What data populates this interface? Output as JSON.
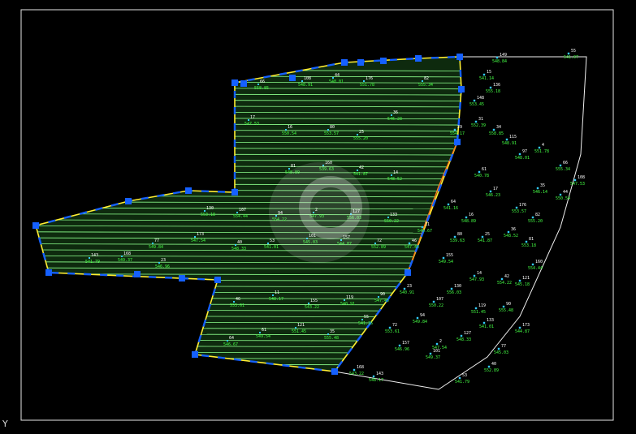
{
  "app": {
    "name": "CAD model space"
  },
  "colors": {
    "background": "#000000",
    "frame": "#e6e6e6",
    "boundary": "#f0f0f0",
    "polyline": "#ffee33",
    "hatch": "#8cff8c",
    "fill": "#0e2a0e",
    "grip": "#1560ff",
    "cut_line": "#ff7a1a",
    "label_text": "#44ff44",
    "label_number": "#ffffff",
    "point_marker": "#33ccff",
    "watermark": "#ffffff"
  },
  "ucs_axis_label": "Y",
  "survey": {
    "spot_elevations": [
      "541.07",
      "548.84",
      "541.14",
      "555.18",
      "553.45",
      "552.39",
      "554.17",
      "558.85",
      "548.91",
      "548.01",
      "551.78",
      "555.34",
      "547.53",
      "550.54",
      "553.57",
      "555.20",
      "546.23",
      "548.89",
      "539.63",
      "541.87",
      "548.52",
      "553.18",
      "554.44",
      "554.22",
      "547.93",
      "556.03",
      "550.22",
      "549.84",
      "547.54",
      "548.33",
      "541.01",
      "545.03",
      "544.87",
      "552.89",
      "541.79",
      "549.37",
      "546.96",
      "553.61",
      "548.17",
      "543.22",
      "540.91",
      "547.45",
      "546.67",
      "549.54",
      "551.45",
      "555.48",
      "541.16",
      "540.78",
      "545.18",
      "546.14"
    ],
    "point_numbers": [
      "55",
      "149",
      "15",
      "136",
      "148",
      "31",
      "29",
      "34",
      "115",
      "97",
      "4",
      "66",
      "108",
      "44",
      "176",
      "82",
      "17",
      "16",
      "80",
      "25",
      "36",
      "81",
      "160",
      "42",
      "14",
      "130",
      "107",
      "94",
      "2",
      "127",
      "133",
      "77",
      "173",
      "40",
      "53",
      "101",
      "157",
      "72",
      "143",
      "168",
      "23",
      "46",
      "11",
      "155",
      "119",
      "90",
      "64",
      "61",
      "121",
      "35"
    ]
  }
}
